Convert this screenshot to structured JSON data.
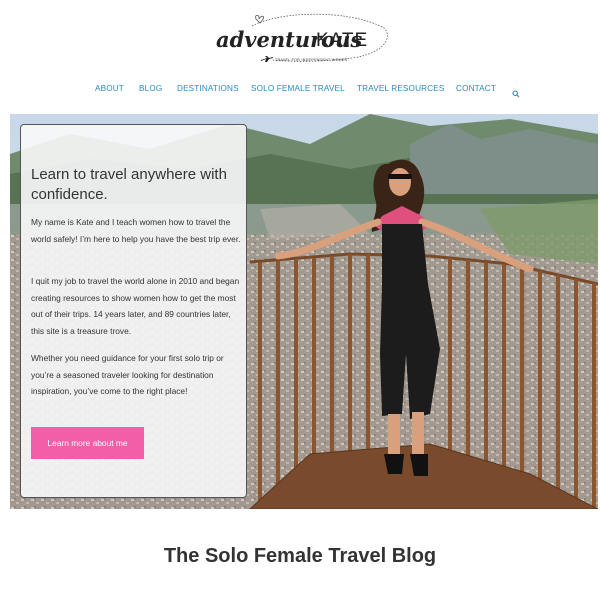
{
  "logo": {
    "script_text": "adventurous",
    "caps_text": "KATE",
    "tagline": "TRAVEL FOR INDEPENDENT WOMEN",
    "icon": "airplane-icon"
  },
  "nav": {
    "items": [
      {
        "label": "ABOUT"
      },
      {
        "label": "BLOG"
      },
      {
        "label": "DESTINATIONS"
      },
      {
        "label": "SOLO FEMALE TRAVEL"
      },
      {
        "label": "TRAVEL RESOURCES"
      },
      {
        "label": "CONTACT"
      }
    ],
    "search_icon": "search-icon"
  },
  "hero": {
    "heading": "Learn to travel anywhere with confidence.",
    "paragraphs": [
      "My name is Kate and I teach women how to travel the world safely! I’m here to help you have the best trip ever.",
      "I quit my job to travel the world alone in 2010 and began creating resources to show women how to get the most out of their trips. 14 years later, and 89 countries later, this site is a treasure trove.",
      "Whether you need guidance for your first solo trip or you’re a seasoned traveler looking for destination inspiration, you’ve come to the right place!"
    ],
    "button_label": "Learn more about me",
    "image": "woman-on-mountain-balcony-photo"
  },
  "section": {
    "title": "The Solo Female Travel Blog"
  },
  "colors": {
    "nav_link": "#2a8bbd",
    "button": "#f15fa8",
    "text": "#333333"
  }
}
